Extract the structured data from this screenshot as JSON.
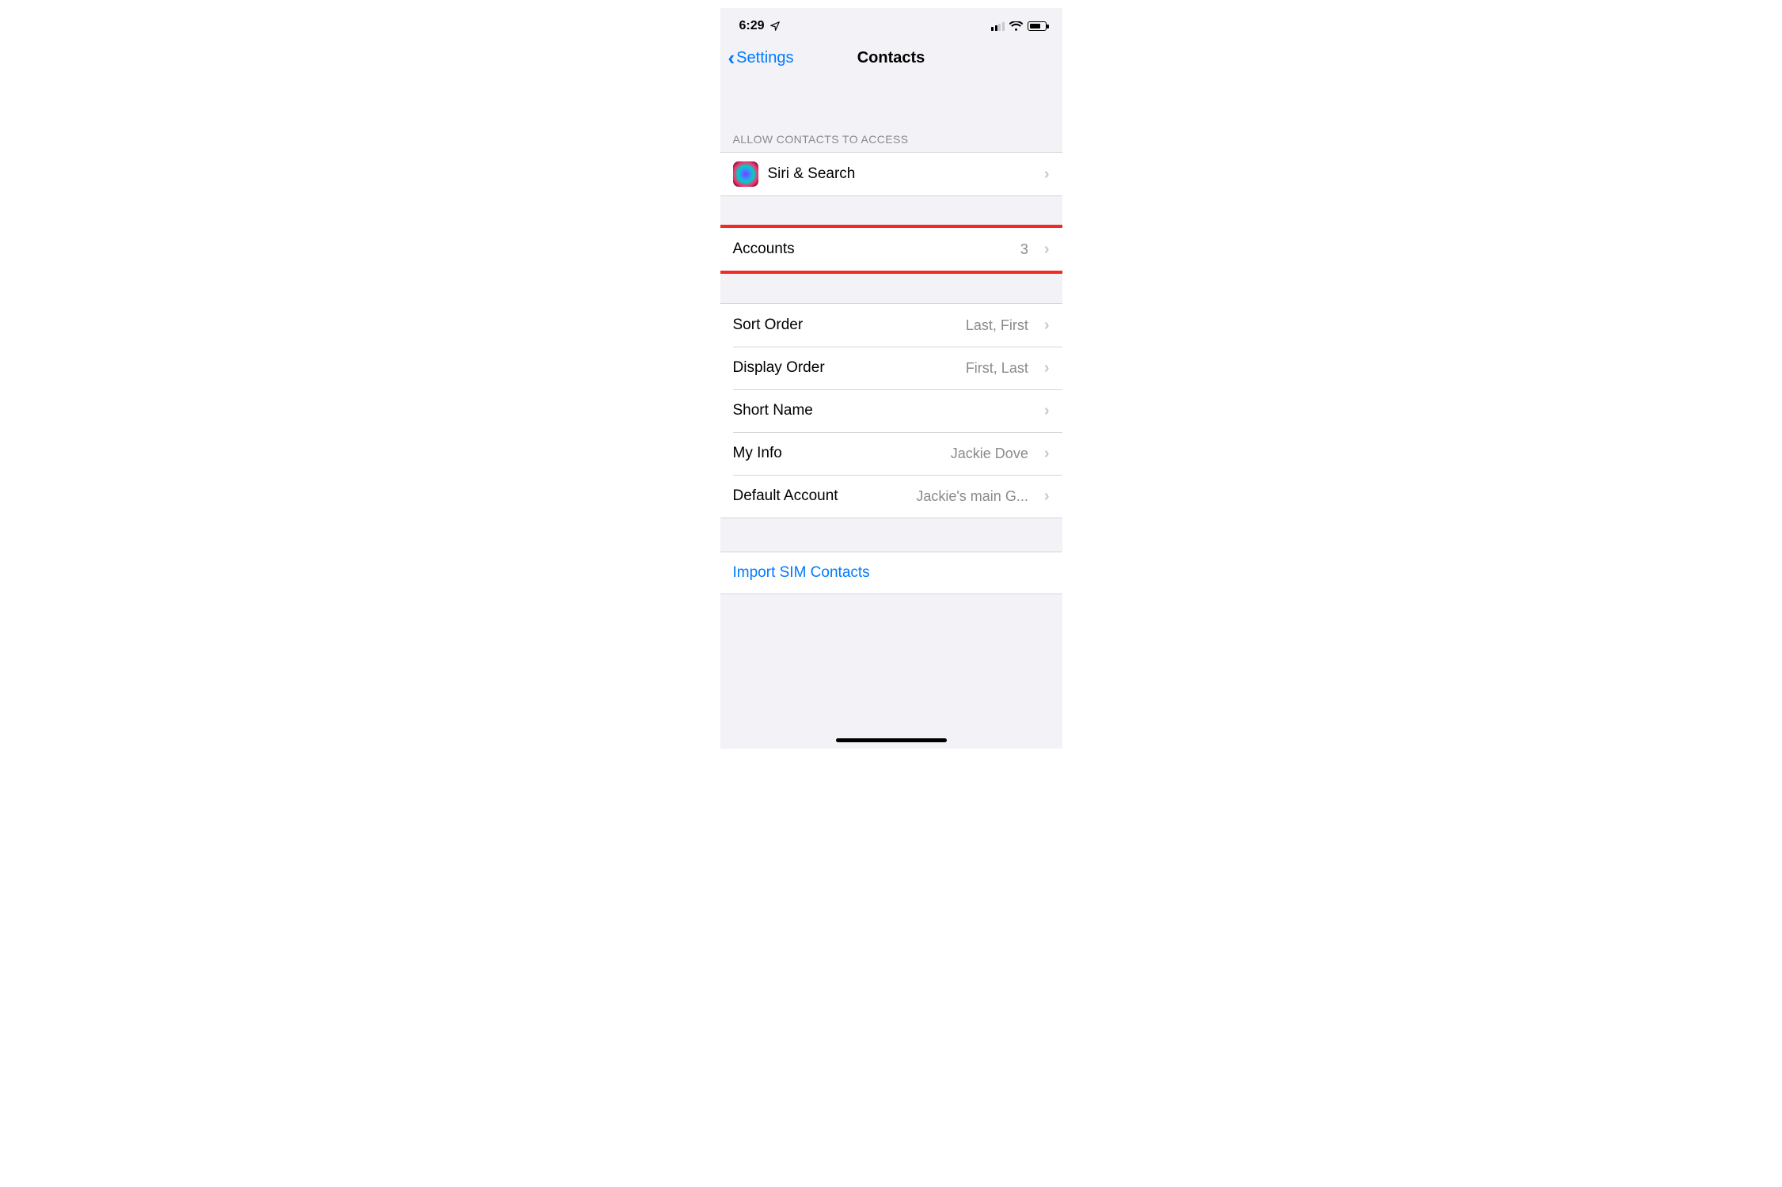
{
  "statusbar": {
    "time": "6:29"
  },
  "nav": {
    "back_label": "Settings",
    "title": "Contacts"
  },
  "section_access": {
    "header": "ALLOW CONTACTS TO ACCESS",
    "siri_label": "Siri & Search"
  },
  "accounts": {
    "label": "Accounts",
    "count": "3"
  },
  "settings": {
    "sort_order": {
      "label": "Sort Order",
      "value": "Last, First"
    },
    "display_order": {
      "label": "Display Order",
      "value": "First, Last"
    },
    "short_name": {
      "label": "Short Name",
      "value": ""
    },
    "my_info": {
      "label": "My Info",
      "value": "Jackie Dove"
    },
    "default_account": {
      "label": "Default Account",
      "value": "Jackie's main G..."
    }
  },
  "import_sim": {
    "label": "Import SIM Contacts"
  }
}
